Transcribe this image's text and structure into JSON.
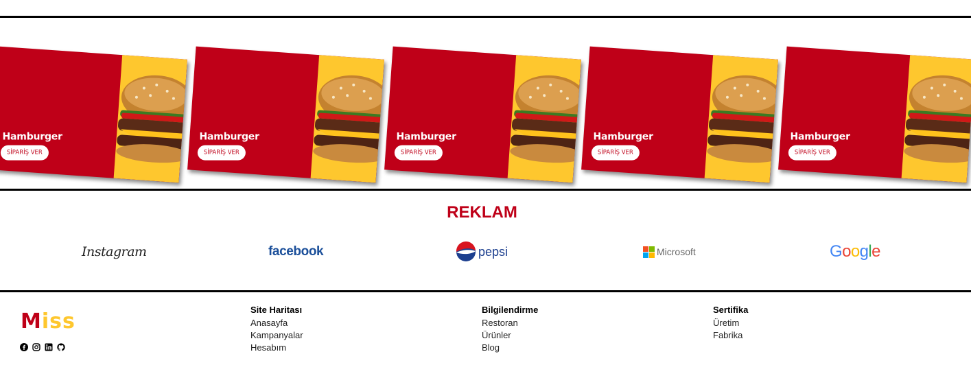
{
  "carousel": {
    "cards": [
      {
        "title": "Hamburger",
        "button": "SİPARİŞ VER"
      },
      {
        "title": "Hamburger",
        "button": "SİPARİŞ VER"
      },
      {
        "title": "Hamburger",
        "button": "SİPARİŞ VER"
      },
      {
        "title": "Hamburger",
        "button": "SİPARİŞ VER"
      },
      {
        "title": "Hamburger",
        "button": "SİPARİŞ VER"
      }
    ]
  },
  "reklam": {
    "title": "REKLAM",
    "logos": {
      "instagram": "Instagram",
      "facebook": "facebook",
      "pepsi": "pepsi",
      "microsoft": "Microsoft",
      "google": "Google"
    }
  },
  "footer": {
    "brand_m": "M",
    "brand_rest": "iss",
    "socials": [
      "facebook-icon",
      "instagram-icon",
      "linkedin-icon",
      "github-icon"
    ],
    "site_map": {
      "title": "Site Haritası",
      "links": [
        "Anasayfa",
        "Kampanyalar",
        "Hesabım"
      ]
    },
    "info": {
      "title": "Bilgilendirme",
      "links": [
        "Restoran",
        "Ürünler",
        "Blog"
      ]
    },
    "cert": {
      "title": "Sertifika",
      "links": [
        "Üretim",
        "Fabrika"
      ]
    }
  },
  "colors": {
    "brand_red": "#bf0018",
    "brand_yellow": "#fec72e",
    "facebook_blue": "#1b4f9a"
  }
}
